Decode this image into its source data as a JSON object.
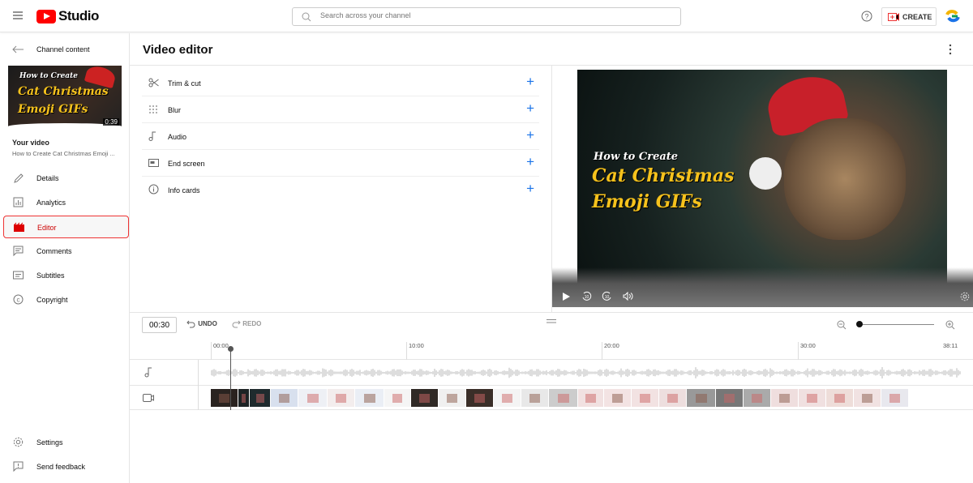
{
  "header": {
    "logo_text": "Studio",
    "search_placeholder": "Search across your channel",
    "create_label": "CREATE"
  },
  "sidebar": {
    "back_label": "Channel content",
    "thumb": {
      "line1": "How to Create",
      "line2": "Cat Christmas",
      "line3": "Emoji GIFs",
      "duration": "0:39"
    },
    "your_video_label": "Your video",
    "video_title": "How to Create Cat Christmas Emoji ...",
    "items": [
      {
        "label": "Details",
        "icon": "pencil-icon"
      },
      {
        "label": "Analytics",
        "icon": "bar-chart-icon"
      },
      {
        "label": "Editor",
        "icon": "clapperboard-icon",
        "active": true
      },
      {
        "label": "Comments",
        "icon": "comment-icon"
      },
      {
        "label": "Subtitles",
        "icon": "subtitles-icon"
      },
      {
        "label": "Copyright",
        "icon": "copyright-icon"
      }
    ],
    "bottom": [
      {
        "label": "Settings",
        "icon": "gear-icon"
      },
      {
        "label": "Send feedback",
        "icon": "feedback-icon"
      }
    ]
  },
  "main": {
    "title": "Video editor",
    "tools": [
      {
        "label": "Trim & cut",
        "icon": "scissors-icon"
      },
      {
        "label": "Blur",
        "icon": "blur-icon"
      },
      {
        "label": "Audio",
        "icon": "music-note-icon"
      },
      {
        "label": "End screen",
        "icon": "end-screen-icon"
      },
      {
        "label": "Info cards",
        "icon": "info-icon"
      }
    ]
  },
  "preview": {
    "line1": "How to Create",
    "line2": "Cat Christmas",
    "line3": "Emoji GIFs"
  },
  "timeline": {
    "time_value": "00:30",
    "undo_label": "UNDO",
    "redo_label": "REDO",
    "ticks": [
      "00:00",
      "10:00",
      "20:00",
      "30:00",
      "38:11"
    ],
    "zoom_level": 0
  },
  "colors": {
    "accent": "#1a73e8",
    "brand": "#ff0000",
    "active_border": "#e33333"
  }
}
